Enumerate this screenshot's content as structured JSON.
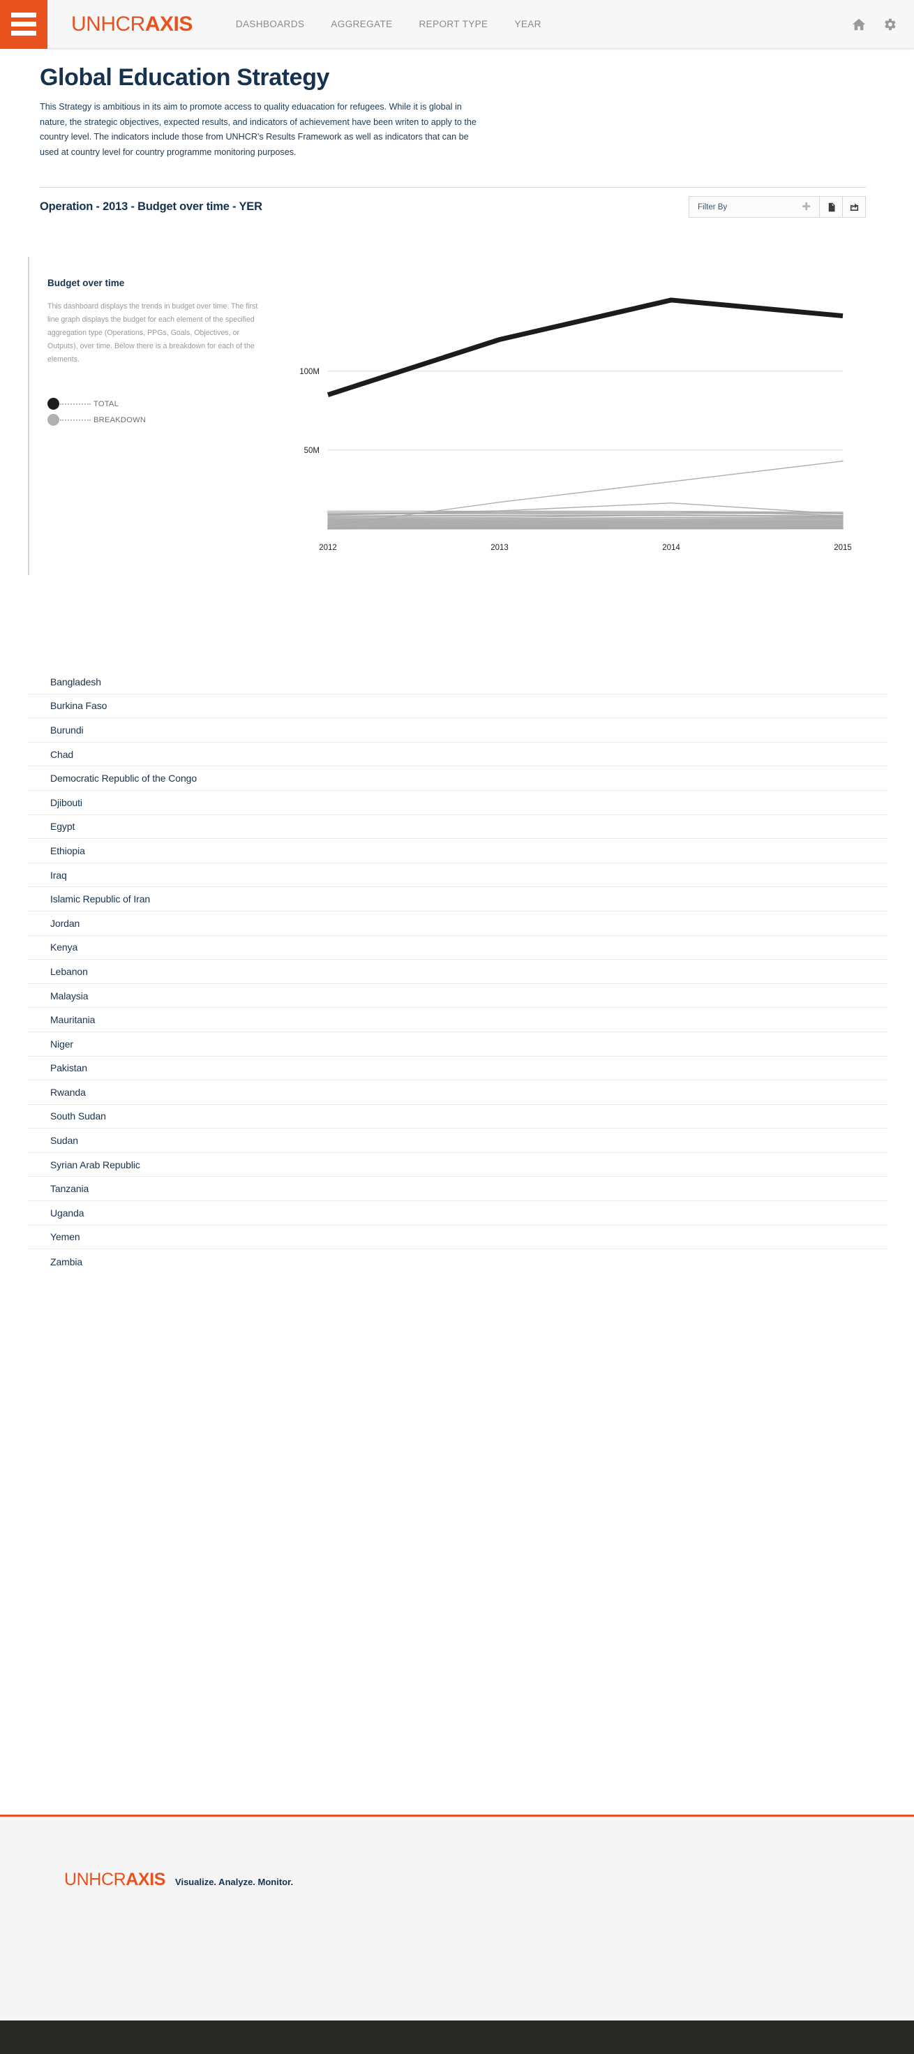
{
  "nav": {
    "menu_icon": "hamburger-icon",
    "brand_prefix": "UNHCR",
    "brand_suffix": "AXIS",
    "links": [
      {
        "label": "DASHBOARDS"
      },
      {
        "label": "AGGREGATE"
      },
      {
        "label": "REPORT TYPE"
      },
      {
        "label": "YEAR"
      }
    ],
    "icons": [
      {
        "name": "home-icon"
      },
      {
        "name": "gear-icon"
      }
    ]
  },
  "page": {
    "title": "Global Education Strategy",
    "description": "This Strategy is ambitious in its aim to promote access to quality eduacation for refugees. While it is global in nature, the strategic objectives, expected results, and indicators of achievement have been writen to apply to the country level. The indicators include those from UNHCR's Results Framework as well as indicators that can be used at country level for country programme monitoring purposes."
  },
  "operation_bar": {
    "title": "Operation - 2013 - Budget over time - YER",
    "filter_label": "Filter By",
    "filter_add_icon": "plus-icon",
    "report_icon": "document-icon",
    "share_icon": "share-export-icon"
  },
  "panel": {
    "title": "Budget over time",
    "description": "This dashboard displays the trends in budget over time. The first line graph displays the budget for each element of the specified aggregation type (Operations, PPGs, Goals, Objectives, or Outputs), over time. Below there is a breakdown for each of the elements.",
    "legend": [
      {
        "label": "TOTAL",
        "color": "#1c1c1c"
      },
      {
        "label": "BREAKDOWN",
        "color": "#b0b0b0"
      }
    ]
  },
  "chart_data": {
    "type": "line",
    "title": "Budget over time",
    "xlabel": "",
    "ylabel": "",
    "x": [
      "2012",
      "2013",
      "2014",
      "2015"
    ],
    "tick_labels_y": [
      "50M",
      "100M"
    ],
    "ylim": [
      0,
      160000000
    ],
    "y_ticks": [
      50000000,
      100000000
    ],
    "grid": true,
    "legend_position": "left",
    "series": [
      {
        "name": "TOTAL",
        "color": "#1c1c1c",
        "width": 7,
        "values": [
          85000000,
          120000000,
          145000000,
          135000000
        ]
      },
      {
        "name": "BREAKDOWN",
        "color": "#a8a8a8",
        "width": 1.4,
        "values": [
          2000000,
          17000000,
          30000000,
          43000000
        ]
      },
      {
        "name": "BREAKDOWN",
        "color": "#a8a8a8",
        "width": 1.4,
        "values": [
          9000000,
          11500000,
          16500000,
          9500000
        ]
      },
      {
        "name": "BREAKDOWN",
        "color": "#a8a8a8",
        "width": 1.4,
        "values": [
          11300000,
          11300000,
          11200000,
          10600000
        ]
      },
      {
        "name": "BREAKDOWN",
        "color": "#a8a8a8",
        "width": 1.4,
        "values": [
          10300000,
          10300000,
          10300000,
          10600000
        ]
      },
      {
        "name": "BREAKDOWN",
        "color": "#a8a8a8",
        "width": 1.4,
        "values": [
          9600000,
          9700000,
          9800000,
          9800000
        ]
      },
      {
        "name": "BREAKDOWN",
        "color": "#a8a8a8",
        "width": 1.4,
        "values": [
          8800000,
          11000000,
          11200000,
          8600000
        ]
      },
      {
        "name": "BREAKDOWN",
        "color": "#a8a8a8",
        "width": 1.4,
        "values": [
          8300000,
          8700000,
          9000000,
          8200000
        ]
      },
      {
        "name": "BREAKDOWN",
        "color": "#a8a8a8",
        "width": 1.4,
        "values": [
          7600000,
          8400000,
          8600000,
          8000000
        ]
      },
      {
        "name": "BREAKDOWN",
        "color": "#a8a8a8",
        "width": 1.4,
        "values": [
          7000000,
          7400000,
          8800000,
          7600000
        ]
      },
      {
        "name": "BREAKDOWN",
        "color": "#a8a8a8",
        "width": 1.4,
        "values": [
          6400000,
          6700000,
          7400000,
          7300000
        ]
      },
      {
        "name": "BREAKDOWN",
        "color": "#a8a8a8",
        "width": 1.4,
        "values": [
          5900000,
          6200000,
          6600000,
          6800000
        ]
      },
      {
        "name": "BREAKDOWN",
        "color": "#a8a8a8",
        "width": 1.4,
        "values": [
          5400000,
          5600000,
          6000000,
          6200000
        ]
      },
      {
        "name": "BREAKDOWN",
        "color": "#a8a8a8",
        "width": 1.4,
        "values": [
          4900000,
          5100000,
          5400000,
          5600000
        ]
      },
      {
        "name": "BREAKDOWN",
        "color": "#a8a8a8",
        "width": 1.4,
        "values": [
          4400000,
          4600000,
          4900000,
          5000000
        ]
      },
      {
        "name": "BREAKDOWN",
        "color": "#a8a8a8",
        "width": 1.4,
        "values": [
          3900000,
          4100000,
          4400000,
          4500000
        ]
      },
      {
        "name": "BREAKDOWN",
        "color": "#a8a8a8",
        "width": 1.4,
        "values": [
          3400000,
          3600000,
          3900000,
          4000000
        ]
      },
      {
        "name": "BREAKDOWN",
        "color": "#a8a8a8",
        "width": 1.4,
        "values": [
          2900000,
          3100000,
          3400000,
          3500000
        ]
      },
      {
        "name": "BREAKDOWN",
        "color": "#a8a8a8",
        "width": 1.4,
        "values": [
          2400000,
          2600000,
          2900000,
          3000000
        ]
      },
      {
        "name": "BREAKDOWN",
        "color": "#a8a8a8",
        "width": 1.4,
        "values": [
          1900000,
          2100000,
          2400000,
          2500000
        ]
      },
      {
        "name": "BREAKDOWN",
        "color": "#a8a8a8",
        "width": 1.4,
        "values": [
          1400000,
          1600000,
          1900000,
          2000000
        ]
      },
      {
        "name": "BREAKDOWN",
        "color": "#a8a8a8",
        "width": 1.4,
        "values": [
          1000000,
          1200000,
          1400000,
          1500000
        ]
      },
      {
        "name": "BREAKDOWN",
        "color": "#a8a8a8",
        "width": 1.4,
        "values": [
          700000,
          900000,
          1000000,
          1100000
        ]
      },
      {
        "name": "BREAKDOWN",
        "color": "#a8a8a8",
        "width": 1.4,
        "values": [
          500000,
          600000,
          700000,
          800000
        ]
      },
      {
        "name": "BREAKDOWN",
        "color": "#a8a8a8",
        "width": 1.4,
        "values": [
          300000,
          400000,
          450000,
          500000
        ]
      },
      {
        "name": "BREAKDOWN",
        "color": "#a8a8a8",
        "width": 1.4,
        "values": [
          150000,
          200000,
          250000,
          260000
        ]
      },
      {
        "name": "BREAKDOWN",
        "color": "#a8a8a8",
        "width": 1.4,
        "values": [
          60000,
          90000,
          110000,
          120000
        ]
      }
    ]
  },
  "countries": [
    {
      "name": "Bangladesh"
    },
    {
      "name": "Burkina Faso"
    },
    {
      "name": "Burundi"
    },
    {
      "name": "Chad"
    },
    {
      "name": "Democratic Republic of the Congo"
    },
    {
      "name": "Djibouti"
    },
    {
      "name": "Egypt"
    },
    {
      "name": "Ethiopia"
    },
    {
      "name": "Iraq"
    },
    {
      "name": "Islamic Republic of Iran"
    },
    {
      "name": "Jordan"
    },
    {
      "name": "Kenya"
    },
    {
      "name": "Lebanon"
    },
    {
      "name": "Malaysia"
    },
    {
      "name": "Mauritania"
    },
    {
      "name": "Niger"
    },
    {
      "name": "Pakistan"
    },
    {
      "name": "Rwanda"
    },
    {
      "name": "South Sudan"
    },
    {
      "name": "Sudan"
    },
    {
      "name": "Syrian Arab Republic"
    },
    {
      "name": "Tanzania"
    },
    {
      "name": "Uganda"
    },
    {
      "name": "Yemen"
    },
    {
      "name": "Zambia"
    }
  ],
  "footer": {
    "brand_prefix": "UNHCR",
    "brand_suffix": "AXIS",
    "tagline": "Visualize. Analyze. Monitor."
  },
  "colors": {
    "brand_orange": "#e8521e",
    "navy": "#17324e",
    "total_line": "#1c1c1c",
    "breakdown_line": "#a8a8a8",
    "footer_dark": "#272724"
  }
}
